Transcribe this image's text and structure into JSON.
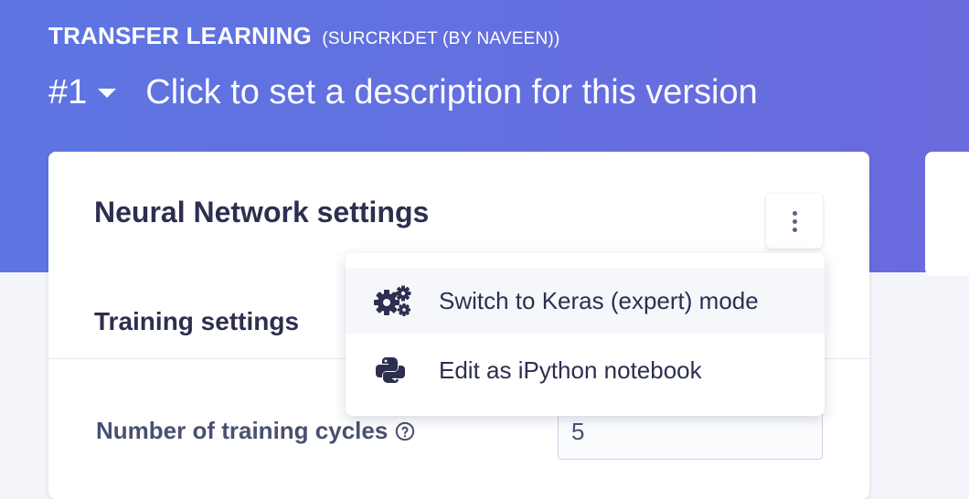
{
  "header": {
    "block_title": "TRANSFER LEARNING",
    "block_subtitle": "(SURCRKDET (BY NAVEEN))",
    "version_number": "#1",
    "version_description_placeholder": "Click to set a description for this version"
  },
  "card": {
    "title": "Neural Network settings",
    "section_title": "Training settings",
    "field_label": "Number of training cycles",
    "field_value": "5"
  },
  "menu": {
    "items": [
      {
        "label": "Switch to Keras (expert) mode",
        "icon": "gears-icon"
      },
      {
        "label": "Edit as iPython notebook",
        "icon": "python-icon"
      }
    ]
  },
  "colors": {
    "hero_start": "#5d75e2",
    "hero_end": "#6a6add",
    "text_dark": "#2c2f4e"
  }
}
